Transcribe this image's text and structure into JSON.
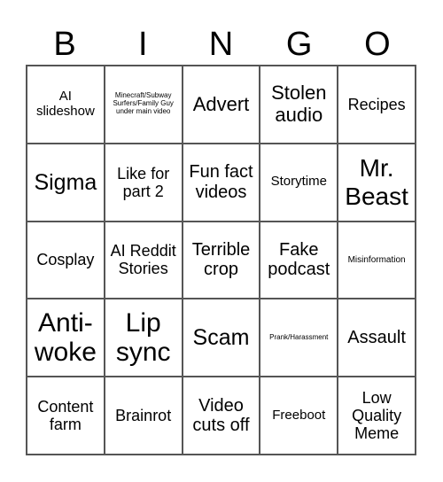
{
  "header": [
    "B",
    "I",
    "N",
    "G",
    "O"
  ],
  "cells": [
    "AI slideshow",
    "Minecraft/Subway Surfers/Family Guy under main video",
    "Advert",
    "Stolen audio",
    "Recipes",
    "Sigma",
    "Like for part 2",
    "Fun fact videos",
    "Storytime",
    "Mr. Beast",
    "Cosplay",
    "AI Reddit Stories",
    "Terrible crop",
    "Fake podcast",
    "Misinformation",
    "Anti-woke",
    "Lip sync",
    "Scam",
    "Prank/Harassment",
    "Assault",
    "Content farm",
    "Brainrot",
    "Video cuts off",
    "Freeboot",
    "Low Quality Meme"
  ]
}
